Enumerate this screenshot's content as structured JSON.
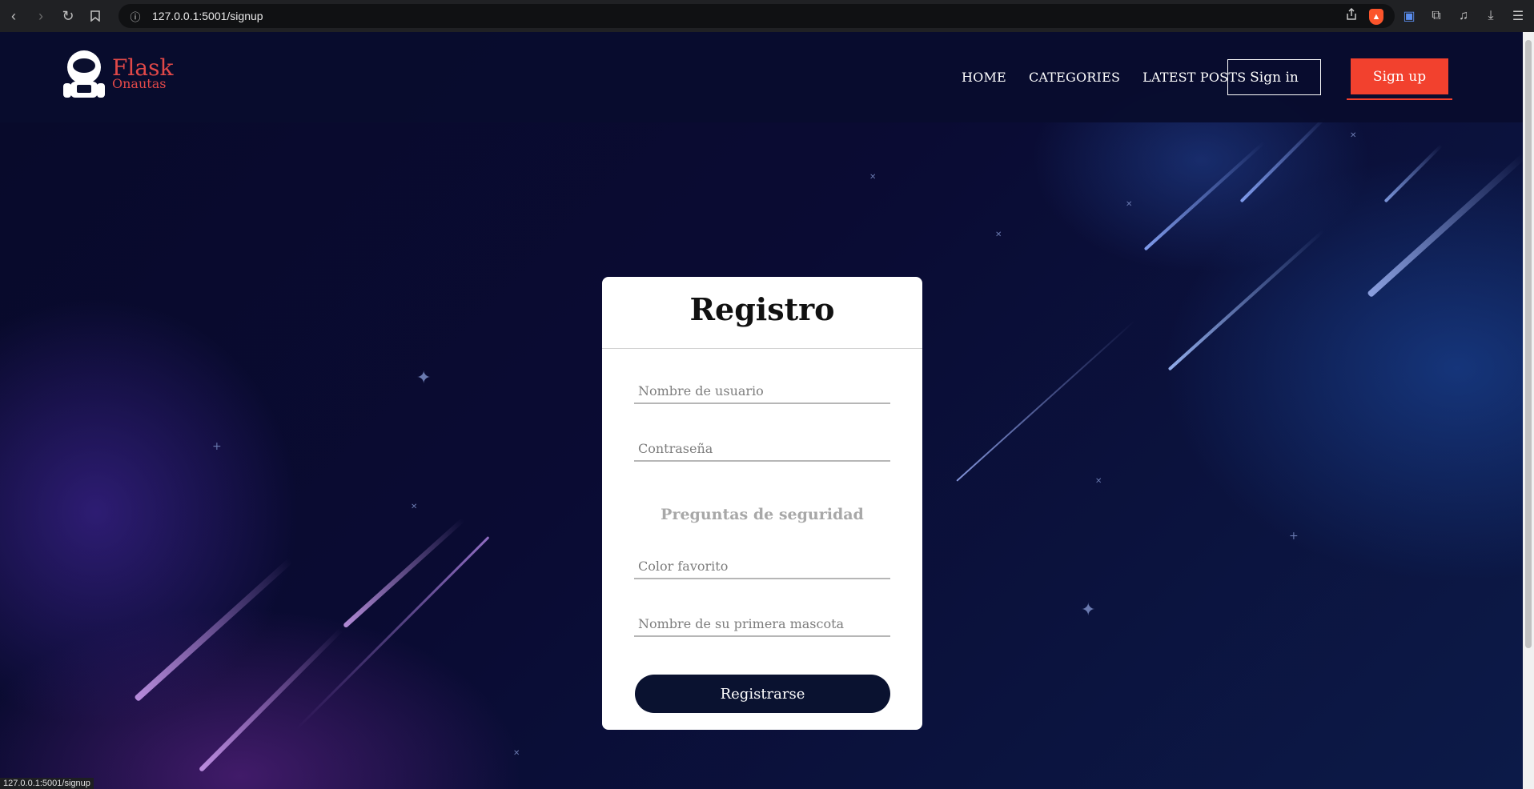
{
  "browser": {
    "url": "127.0.0.1:5001/signup",
    "status_url": "127.0.0.1:5001/signup"
  },
  "header": {
    "logo_line1": "Flask",
    "logo_line2": "Onautas",
    "nav": [
      "HOME",
      "CATEGORIES",
      "LATEST POSTS"
    ],
    "signin_label": "Sign in",
    "signup_label": "Sign up"
  },
  "form": {
    "title": "Registro",
    "username_placeholder": "Nombre de usuario",
    "password_placeholder": "Contraseña",
    "security_heading": "Preguntas de seguridad",
    "color_placeholder": "Color favorito",
    "pet_placeholder": "Nombre de su primera mascota",
    "submit_label": "Registrarse"
  },
  "colors": {
    "accent": "#f2412e",
    "button_dark": "#0a1230",
    "background": "#07092a"
  },
  "icons": [
    "back-icon",
    "forward-icon",
    "reload-icon",
    "bookmark-icon",
    "info-icon",
    "share-icon",
    "brave-shield-icon",
    "translate-icon",
    "extensions-icon",
    "media-icon",
    "download-icon",
    "menu-icon"
  ]
}
